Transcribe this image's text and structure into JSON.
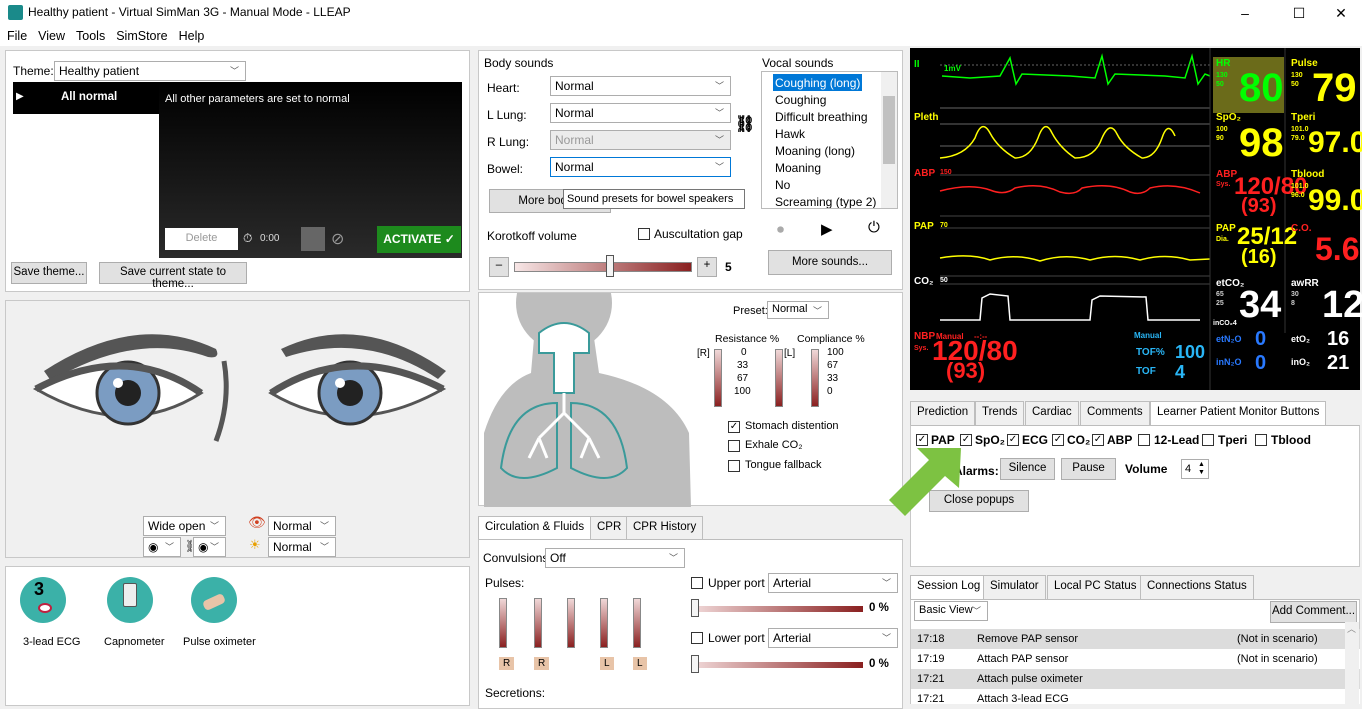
{
  "window": {
    "title": "Healthy patient - Virtual SimMan 3G - Manual Mode - LLEAP",
    "minimize": "–",
    "maximize": "☐",
    "close": "✕"
  },
  "menu": [
    "File",
    "View",
    "Tools",
    "SimStore",
    "Help"
  ],
  "theme": {
    "label": "Theme:",
    "value": "Healthy patient",
    "item": "All normal",
    "desc": "All other parameters are set to normal",
    "delete": "Delete",
    "timer": "0:00",
    "activate": "ACTIVATE ✓",
    "save_theme": "Save theme...",
    "save_state": "Save current state to theme..."
  },
  "sounds": {
    "header": "Body sounds",
    "heart_label": "Heart:",
    "heart": "Normal",
    "llung_label": "L Lung:",
    "llung": "Normal",
    "rlung_label": "R Lung:",
    "rlung": "Normal",
    "bowel_label": "Bowel:",
    "bowel": "Normal",
    "more_body": "More body s",
    "tooltip": "Sound presets for bowel speakers",
    "korotkoff": "Korotkoff volume",
    "ausc": "Auscultation gap",
    "vol_minus": "–",
    "vol_plus": "+",
    "vol": "5"
  },
  "vocal": {
    "header": "Vocal sounds",
    "items": [
      "Coughing (long)",
      "Coughing",
      "Difficult breathing",
      "Hawk",
      "Moaning (long)",
      "Moaning",
      "No",
      "Screaming (type 2)"
    ],
    "more": "More sounds..."
  },
  "eyes": {
    "lid": "Wide open",
    "pupil_l": "◉",
    "pupil_r": "◉",
    "react1": "Normal",
    "react2": "Normal"
  },
  "devices": [
    {
      "label": "3-lead ECG"
    },
    {
      "label": "Capnometer"
    },
    {
      "label": "Pulse oximeter"
    }
  ],
  "ecg_badge": "3",
  "airway": {
    "preset_label": "Preset:",
    "preset": "Normal",
    "resistance": "Resistance %",
    "compliance": "Compliance %",
    "r_label": "[R]",
    "l_label": "[L]",
    "res_ticks": [
      "0",
      "33",
      "67",
      "100"
    ],
    "comp_ticks": [
      "100",
      "67",
      "33",
      "0"
    ],
    "stomach": "Stomach distention",
    "exhale": "Exhale CO₂",
    "tongue": "Tongue fallback"
  },
  "circ": {
    "tabs": [
      "Circulation & Fluids",
      "CPR",
      "CPR History"
    ],
    "convulsions_label": "Convulsions:",
    "convulsions": "Off",
    "pulses": "Pulses:",
    "upper": "Upper port",
    "upper_val": "Arterial",
    "upper_pct": "0 %",
    "lower": "Lower port",
    "lower_val": "Arterial",
    "lower_pct": "0 %",
    "secretions": "Secretions:",
    "pulse_labels": [
      "R",
      "R",
      "",
      "L",
      "L"
    ]
  },
  "monitor": {
    "ii": "II",
    "mv": "1mV",
    "pleth": "Pleth",
    "abp": "ABP",
    "abp_scale": "150",
    "pap": "PAP",
    "pap_scale": "70",
    "co2": "CO₂",
    "co2_scale": "50",
    "hr_label": "HR",
    "hr_lim": "130",
    "hr_lim2": "50",
    "hr": "80",
    "pulse_label": "Pulse",
    "pulse_lim": "130",
    "pulse_lim2": "50",
    "pulse": "79",
    "spo2_label": "SpO₂",
    "spo2_lim": "100",
    "spo2_lim2": "90",
    "spo2": "98",
    "tperi_label": "Tperi",
    "tperi_lim": "101.0",
    "tperi_lim2": "79.0",
    "tperi": "97.0",
    "abp_label": "ABP",
    "abp_sys": "Sys.",
    "abp_val": "120/80",
    "abp_mean": "(93)",
    "tblood_label": "Tblood",
    "tblood_lim": "101.0",
    "tblood_lim2": "96.0",
    "tblood": "99.0",
    "pap_label": "PAP",
    "pap_dia": "Dia.",
    "pap_val": "25/12",
    "pap_mean": "(16)",
    "co_label": "C.O.",
    "co": "5.6",
    "etco2_label": "etCO₂",
    "etco2_lim": "65",
    "etco2_lim2": "25",
    "etco2": "34",
    "awrr_label": "awRR",
    "awrr_lim": "30",
    "awrr_lim2": "8",
    "awrr": "12",
    "inco2": "inCO₂4",
    "nbp_label": "NBP",
    "nbp_manual": "Manual",
    "nbp_time": "--:--",
    "nbp_sys": "Sys.",
    "nbp_val": "120/80",
    "nbp_mean": "(93)",
    "tof_manual": "Manual",
    "tofpct_label": "TOF%",
    "tofpct": "100",
    "tof_label": "TOF",
    "tof": "4",
    "etn2o_label": "etN₂O",
    "etn2o": "0",
    "inn2o_label": "inN₂O",
    "inn2o": "0",
    "eto2_label": "etO₂",
    "eto2": "16",
    "ino2_label": "inO₂",
    "ino2": "21"
  },
  "lpm": {
    "tabs": [
      "Prediction",
      "Trends",
      "Cardiac",
      "Comments",
      "Learner Patient Monitor Buttons"
    ],
    "checks": [
      "PAP",
      "SpO₂",
      "ECG",
      "CO₂",
      "ABP",
      "12-Lead",
      "Tperi",
      "Tblood"
    ],
    "alarms": "Alarms:",
    "silence": "Silence",
    "pause": "Pause",
    "volume": "Volume",
    "volume_val": "4",
    "close": "Close popups"
  },
  "log": {
    "tabs": [
      "Session Log",
      "Simulator",
      "Local PC Status",
      "Connections Status"
    ],
    "view": "Basic View",
    "add": "Add Comment...",
    "rows": [
      {
        "time": "17:18",
        "event": "Remove PAP sensor",
        "note": "(Not in scenario)"
      },
      {
        "time": "17:19",
        "event": "Attach PAP sensor",
        "note": "(Not in scenario)"
      },
      {
        "time": "17:21",
        "event": "Attach pulse oximeter",
        "note": ""
      },
      {
        "time": "17:21",
        "event": "Attach 3-lead ECG",
        "note": ""
      }
    ]
  },
  "colors": {
    "ecg": "#00ff00",
    "pleth": "#ffff00",
    "abp": "#ff2020",
    "pap": "#ffff00",
    "co2": "#ffffff",
    "accent": "#0078d7",
    "activate": "#1d8a1d",
    "arrow": "#7dc242"
  }
}
